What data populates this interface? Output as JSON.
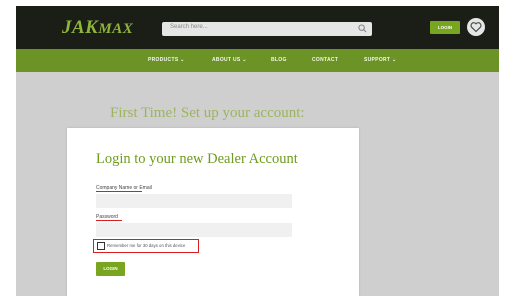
{
  "header": {
    "logo_main": "JAK",
    "logo_rest": "MAX",
    "search_placeholder": "Search here...",
    "login_label": "LOGIN",
    "search_icon": "search-icon",
    "heart_icon": "heart-icon"
  },
  "nav": {
    "items": [
      {
        "label": "PRODUCTS ⌄"
      },
      {
        "label": "ABOUT US ⌄"
      },
      {
        "label": "BLOG"
      },
      {
        "label": "CONTACT"
      },
      {
        "label": "SUPPORT ⌄"
      }
    ]
  },
  "headline": "First Time! Set up your account:",
  "login_form": {
    "title": "Login to your new Dealer Account",
    "company_label": "Company Name or Email",
    "company_value": "",
    "password_label": "Password",
    "password_value": "",
    "remember_label": "Remember me for 30 days on this device",
    "remember_checked": false,
    "login_button": "LOGIN"
  },
  "colors": {
    "brand_green": "#79a621",
    "nav_green": "#6c9325",
    "header_dark": "#1b1d17",
    "highlight_red": "#d81f1f"
  }
}
